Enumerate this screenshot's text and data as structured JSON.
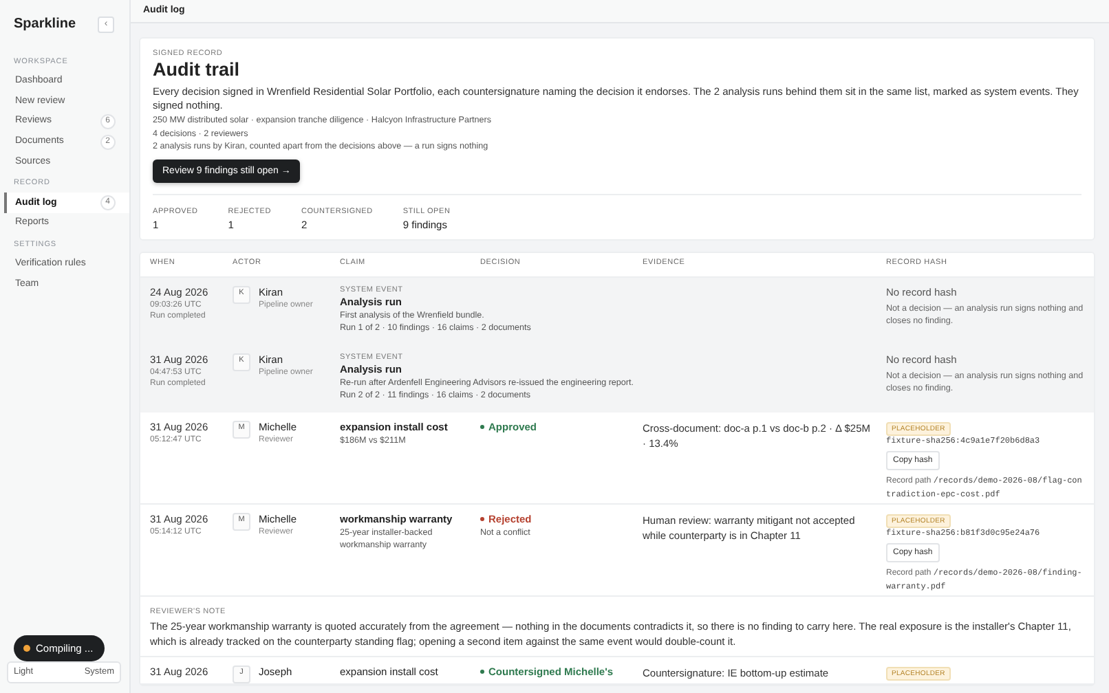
{
  "sidebar": {
    "brand": "Sparkline",
    "collapse_glyph": "‹",
    "sections": [
      {
        "heading": "WORKSPACE",
        "items": [
          {
            "label": "Dashboard",
            "selected": false
          },
          {
            "label": "New review",
            "selected": false
          },
          {
            "label": "Reviews",
            "count": "6",
            "selected": false
          },
          {
            "label": "Documents",
            "count": "2",
            "selected": false
          },
          {
            "label": "Sources",
            "selected": false
          }
        ]
      },
      {
        "heading": "RECORD",
        "items": [
          {
            "label": "Audit log",
            "count": "4",
            "selected": true
          },
          {
            "label": "Reports",
            "selected": false
          }
        ]
      },
      {
        "heading": "SETTINGS",
        "items": [
          {
            "label": "Verification rules",
            "selected": false
          },
          {
            "label": "Team",
            "selected": false
          }
        ]
      }
    ],
    "theme_options": [
      "Light",
      "System"
    ]
  },
  "topbar": {
    "title": "Audit log"
  },
  "summary": {
    "eyebrow": "SIGNED RECORD",
    "title": "Audit trail",
    "description": "Every decision signed in Wrenfield Residential Solar Portfolio, each countersignature naming the decision it endorses. The 2 analysis runs behind them sit in the same list, marked as system events. They signed nothing.",
    "meta": [
      "250 MW distributed solar · expansion tranche diligence · Halcyon Infrastructure Partners",
      "4 decisions · 2 reviewers",
      "2 analysis runs by Kiran, counted apart from the decisions above — a run signs nothing"
    ],
    "button": "Review 9 findings still open →",
    "stats": [
      {
        "label": "APPROVED",
        "value": "1"
      },
      {
        "label": "REJECTED",
        "value": "1"
      },
      {
        "label": "COUNTERSIGNED",
        "value": "2"
      },
      {
        "label": "STILL OPEN",
        "value": "9 findings"
      }
    ]
  },
  "table": {
    "columns": [
      "WHEN",
      "ACTOR",
      "CLAIM",
      "DECISION",
      "EVIDENCE",
      "RECORD HASH"
    ],
    "rows": [
      {
        "kind": "system",
        "date": "24 Aug 2026",
        "time": "09:03:26 UTC",
        "status": "Run completed",
        "avatar": "K",
        "actor": "Kiran",
        "role": "Pipeline owner",
        "event": "SYSTEM EVENT",
        "claim": "Analysis run",
        "claim_detail": "First analysis of the Wrenfield bundle.",
        "claim_meta": "Run 1 of 2 · 10 findings · 16 claims · 2 documents",
        "hash_title": "No record hash",
        "hash_note": "Not a decision — an analysis run signs nothing and closes no finding."
      },
      {
        "kind": "system",
        "date": "31 Aug 2026",
        "time": "04:47:53 UTC",
        "status": "Run completed",
        "avatar": "K",
        "actor": "Kiran",
        "role": "Pipeline owner",
        "event": "SYSTEM EVENT",
        "claim": "Analysis run",
        "claim_detail": "Re-run after Ardenfell Engineering Advisors re-issued the engineering report.",
        "claim_meta": "Run 2 of 2 · 11 findings · 16 claims · 2 documents",
        "hash_title": "No record hash",
        "hash_note": "Not a decision — an analysis run signs nothing and closes no finding."
      },
      {
        "kind": "decision",
        "date": "31 Aug 2026",
        "time": "05:12:47 UTC",
        "avatar": "M",
        "actor": "Michelle",
        "role": "Reviewer",
        "claim": "expansion install cost",
        "claim_detail": "$186M vs $211M",
        "decision": {
          "label": "Approved",
          "color": "#2f7a4f"
        },
        "evidence": "Cross-document: doc-a p.1 vs doc-b p.2 · Δ $25M · 13.4%",
        "badge": "PLACEHOLDER",
        "hash": "fixture-sha256:4c9a1e7f20b6d8a3",
        "copy": "Copy hash",
        "path_label": "Record path",
        "path": "/records/demo-2026-08/flag-contradiction-epc-cost.pdf"
      },
      {
        "kind": "decision",
        "date": "31 Aug 2026",
        "time": "05:14:12 UTC",
        "avatar": "M",
        "actor": "Michelle",
        "role": "Reviewer",
        "claim": "workmanship warranty",
        "claim_detail": "25-year installer-backed workmanship warranty",
        "decision": {
          "label": "Rejected",
          "color": "#b5412f",
          "note": "Not a conflict"
        },
        "evidence": "Human review: warranty mitigant not accepted while counterparty is in Chapter 11",
        "badge": "PLACEHOLDER",
        "hash": "fixture-sha256:b81f3d0c95e24a76",
        "copy": "Copy hash",
        "path_label": "Record path",
        "path": "/records/demo-2026-08/finding-warranty.pdf"
      },
      {
        "kind": "note",
        "heading": "REVIEWER'S NOTE",
        "text": "The 25-year workmanship warranty is quoted accurately from the agreement — nothing in the documents contradicts it, so there is no finding to carry here. The real exposure is the installer's Chapter 11, which is already tracked on the counterparty standing flag; opening a second item against the same event would double-count it."
      },
      {
        "kind": "cut",
        "date": "31 Aug 2026",
        "avatar": "J",
        "actor": "Joseph",
        "claim": "expansion install cost",
        "decision": {
          "label": "Countersigned Michelle's",
          "color": "#2f7a4f"
        },
        "evidence": "Countersignature: IE bottom-up estimate",
        "badge": "PLACEHOLDER"
      }
    ]
  },
  "toast": {
    "text": "Compiling ..."
  }
}
